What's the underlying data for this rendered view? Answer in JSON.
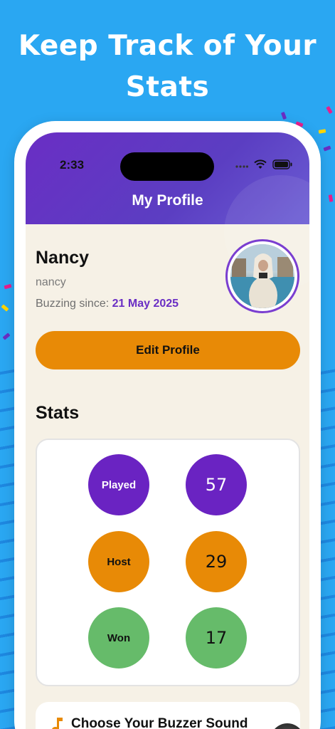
{
  "headline": {
    "line1": "Keep Track of Your",
    "line2": "Stats"
  },
  "status_bar": {
    "time": "2:33",
    "icons": [
      "signal-icon",
      "wifi-icon",
      "battery-icon"
    ]
  },
  "header": {
    "title": "My Profile"
  },
  "profile": {
    "name": "Nancy",
    "username": "nancy",
    "since_label": "Buzzing since:",
    "since_date": "21 May 2025"
  },
  "edit_button": {
    "label": "Edit Profile"
  },
  "stats": {
    "heading": "Stats",
    "rows": [
      {
        "label": "Played",
        "value": "57",
        "color": "#6a23c2",
        "label_color": "#ffffff"
      },
      {
        "label": "Host",
        "value": "29",
        "color": "#e88a06",
        "label_color": "#111111"
      },
      {
        "label": "Won",
        "value": "17",
        "color": "#66bb6a",
        "label_color": "#111111"
      }
    ]
  },
  "buzzer": {
    "label": "Choose Your Buzzer Sound",
    "icon": "music-note-icon"
  },
  "colors": {
    "background": "#2aa7f2",
    "brand_purple": "#6a2ec4",
    "accent_orange": "#e88a06",
    "card_bg": "#f6f1e6"
  }
}
